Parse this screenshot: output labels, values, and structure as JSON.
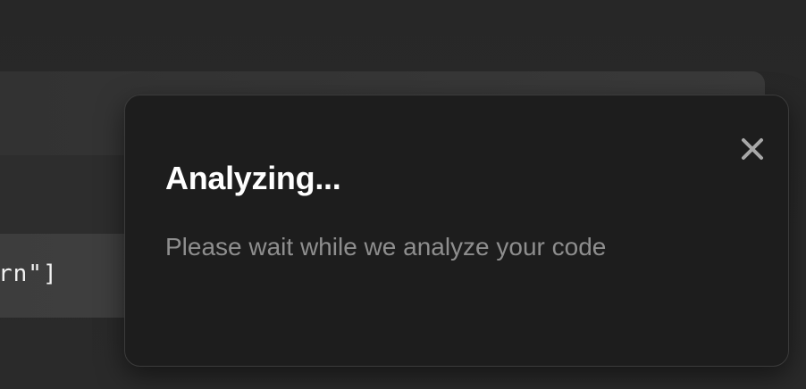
{
  "background": {
    "code_fragment": "rn\"]"
  },
  "dialog": {
    "title": "Analyzing...",
    "message": "Please wait while we analyze your code",
    "close_icon": "close-icon"
  },
  "colors": {
    "dialog_bg": "#1d1d1d",
    "title": "#ffffff",
    "message": "#8e8e8e",
    "close_icon": "#a8a8a8"
  }
}
